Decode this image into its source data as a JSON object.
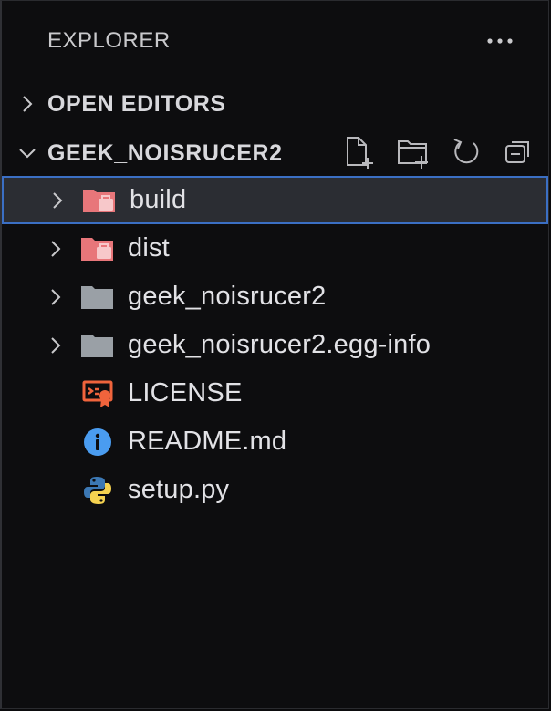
{
  "explorer": {
    "title": "EXPLORER"
  },
  "open_editors": {
    "label": "OPEN EDITORS"
  },
  "workspace": {
    "label": "GEEK_NOISRUCER2"
  },
  "tree": [
    {
      "name": "build",
      "kind": "folder-special",
      "icon": "folder-package-icon",
      "selected": true
    },
    {
      "name": "dist",
      "kind": "folder-special",
      "icon": "folder-package-icon",
      "selected": false
    },
    {
      "name": "geek_noisrucer2",
      "kind": "folder",
      "icon": "folder-icon",
      "selected": false
    },
    {
      "name": "geek_noisrucer2.egg-info",
      "kind": "folder",
      "icon": "folder-icon",
      "selected": false
    },
    {
      "name": "LICENSE",
      "kind": "file",
      "icon": "license-icon",
      "selected": false
    },
    {
      "name": "README.md",
      "kind": "file",
      "icon": "info-icon",
      "selected": false
    },
    {
      "name": "setup.py",
      "kind": "file",
      "icon": "python-icon",
      "selected": false
    }
  ],
  "colors": {
    "background": "#0d0d0f",
    "selection_bg": "#2b2d33",
    "selection_border": "#3b6fc4",
    "folder_special": "#e8767a",
    "folder": "#9aa0a6",
    "license": "#f0643c",
    "info": "#4a9cf0",
    "python_blue": "#3c78b4",
    "python_yellow": "#f5d250"
  }
}
